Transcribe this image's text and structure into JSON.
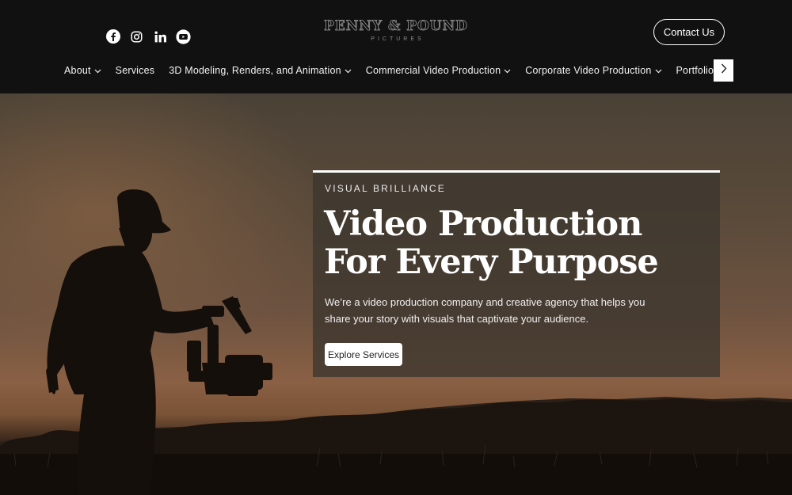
{
  "header": {
    "social": [
      {
        "name": "facebook-icon"
      },
      {
        "name": "instagram-icon"
      },
      {
        "name": "linkedin-icon"
      },
      {
        "name": "youtube-icon"
      }
    ],
    "logo": {
      "main": "PENNY & POUND",
      "sub": "PICTURES"
    },
    "contact_label": "Contact Us",
    "nav": [
      {
        "label": "About",
        "has_dropdown": true
      },
      {
        "label": "Services",
        "has_dropdown": false
      },
      {
        "label": "3D Modeling, Renders, and Animation",
        "has_dropdown": true
      },
      {
        "label": "Commercial Video Production",
        "has_dropdown": true
      },
      {
        "label": "Corporate Video Production",
        "has_dropdown": true
      },
      {
        "label": "Portfolio",
        "has_dropdown": false
      }
    ]
  },
  "hero": {
    "eyebrow": "VISUAL BRILLIANCE",
    "headline": "Video Production For Every Purpose",
    "description": "We’re a video production company and creative agency that helps you share your story with visuals that captivate your audience.",
    "cta_label": "Explore Services"
  },
  "colors": {
    "header_bg": "#111111",
    "card_bg": "#3c362e",
    "accent_white": "#ffffff"
  }
}
